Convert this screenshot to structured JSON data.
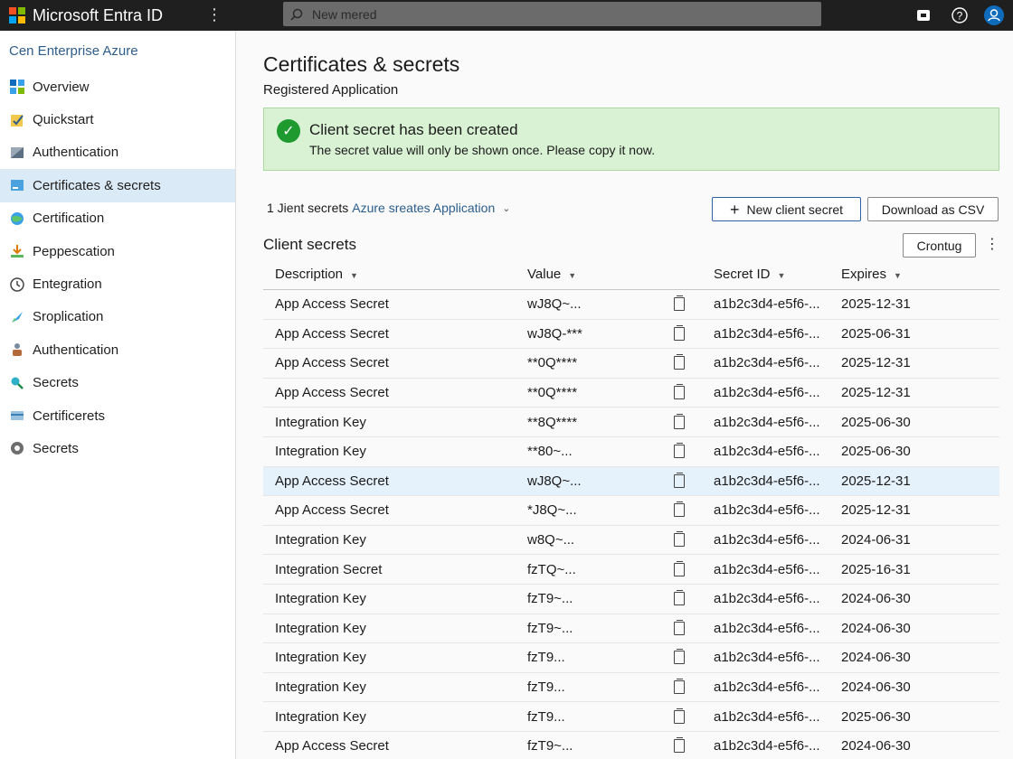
{
  "app": {
    "title": "Microsoft Entra ID",
    "search_placeholder": "New mered"
  },
  "sidebar": {
    "tenant": "Cen Enterprise Azure",
    "items": [
      {
        "label": "Overview",
        "icon": "grid-icon",
        "active": false
      },
      {
        "label": "Quickstart",
        "icon": "lightning-icon",
        "active": false
      },
      {
        "label": "Authentication",
        "icon": "auth-icon",
        "active": false
      },
      {
        "label": "Certificates & secrets",
        "icon": "certificate-icon",
        "active": true
      },
      {
        "label": "Certification",
        "icon": "globe-icon",
        "active": false
      },
      {
        "label": "Peppescation",
        "icon": "download-icon",
        "active": false
      },
      {
        "label": "Entegration",
        "icon": "clock-icon",
        "active": false
      },
      {
        "label": "Sroplication",
        "icon": "rocket-icon",
        "active": false
      },
      {
        "label": "Authentication",
        "icon": "users-icon",
        "active": false
      },
      {
        "label": "Secrets",
        "icon": "key-icon",
        "active": false
      },
      {
        "label": "Certificerets",
        "icon": "card-icon",
        "active": false
      },
      {
        "label": "Secrets",
        "icon": "gear-icon",
        "active": false
      }
    ]
  },
  "main": {
    "title": "Certificates & secrets",
    "subtitle": "Registered Application",
    "banner": {
      "title": "Client secret has been created",
      "text": "The secret value will only be shown once. Please copy it now."
    },
    "filter": {
      "prefix": "1 Jient secrets",
      "link": "Azure sreates Application"
    },
    "buttons": {
      "new_secret": "New client secret",
      "download_csv": "Download as CSV",
      "configure": "Crontug"
    },
    "section_title": "Client secrets",
    "columns": [
      "Description",
      "Value",
      "Secret ID",
      "Expires"
    ],
    "rows": [
      {
        "description": "App Access Secret",
        "value": "wJ8Q~...",
        "secret_id": "a1b2c3d4-e5f6-...",
        "expires": "2025-12-31",
        "selected": false
      },
      {
        "description": "App Access Secret",
        "value": "wJ8Q-***",
        "secret_id": "a1b2c3d4-e5f6-...",
        "expires": "2025-06-31",
        "selected": false
      },
      {
        "description": "App Access Secret",
        "value": "**0Q****",
        "secret_id": "a1b2c3d4-e5f6-...",
        "expires": "2025-12-31",
        "selected": false
      },
      {
        "description": "App Access Secret",
        "value": "**0Q****",
        "secret_id": "a1b2c3d4-e5f6-...",
        "expires": "2025-12-31",
        "selected": false
      },
      {
        "description": "Integration Key",
        "value": "**8Q****",
        "secret_id": "a1b2c3d4-e5f6-...",
        "expires": "2025-06-30",
        "selected": false
      },
      {
        "description": "Integration Key",
        "value": "**80~...",
        "secret_id": "a1b2c3d4-e5f6-...",
        "expires": "2025-06-30",
        "selected": false
      },
      {
        "description": "App Access Secret",
        "value": "wJ8Q~...",
        "secret_id": "a1b2c3d4-e5f6-...",
        "expires": "2025-12-31",
        "selected": true
      },
      {
        "description": "App Access Secret",
        "value": "*J8Q~...",
        "secret_id": "a1b2c3d4-e5f6-...",
        "expires": "2025-12-31",
        "selected": false
      },
      {
        "description": "Integration Key",
        "value": "w8Q~...",
        "secret_id": "a1b2c3d4-e5f6-...",
        "expires": "2024-06-31",
        "selected": false
      },
      {
        "description": "Integration Secret",
        "value": "fzTQ~...",
        "secret_id": "a1b2c3d4-e5f6-...",
        "expires": "2025-16-31",
        "selected": false
      },
      {
        "description": "Integration Key",
        "value": "fzT9~...",
        "secret_id": "a1b2c3d4-e5f6-...",
        "expires": "2024-06-30",
        "selected": false
      },
      {
        "description": "Integration Key",
        "value": "fzT9~...",
        "secret_id": "a1b2c3d4-e5f6-...",
        "expires": "2024-06-30",
        "selected": false
      },
      {
        "description": "Integration Key",
        "value": "fzT9...",
        "secret_id": "a1b2c3d4-e5f6-...",
        "expires": "2024-06-30",
        "selected": false
      },
      {
        "description": "Integration Key",
        "value": "fzT9...",
        "secret_id": "a1b2c3d4-e5f6-...",
        "expires": "2024-06-30",
        "selected": false
      },
      {
        "description": "Integration Key",
        "value": "fzT9...",
        "secret_id": "a1b2c3d4-e5f6-...",
        "expires": "2025-06-30",
        "selected": false
      },
      {
        "description": "App Access Secret",
        "value": "fzT9~...",
        "secret_id": "a1b2c3d4-e5f6-...",
        "expires": "2024-06-30",
        "selected": false
      }
    ]
  },
  "colors": {
    "topbar": "#1f1f1f",
    "accent": "#0f6cbd",
    "success": "#1e9a2f",
    "selected_row": "#e5f1fb"
  }
}
